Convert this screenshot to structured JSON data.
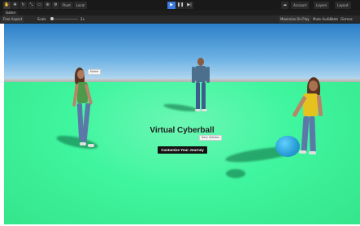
{
  "toolbar": {
    "tool_icons": [
      "hand-icon",
      "move-icon",
      "rotate-icon",
      "scale-icon",
      "rect-icon",
      "transform-icon",
      "custom-icon"
    ],
    "pivot_label": "Pivot",
    "local_label": "Local",
    "play_icons": [
      "play-icon",
      "pause-icon",
      "step-icon"
    ],
    "account_label": "Account",
    "layers_label": "Layers",
    "layout_label": "Layout"
  },
  "tab": {
    "label": "Game"
  },
  "gamebar": {
    "aspect": "Free Aspect",
    "scale_label": "Scale",
    "scale_value": "2x",
    "maximize": "Maximize On Play",
    "mute": "Mute Audio",
    "stats": "Stats",
    "gizmos": "Gizmos"
  },
  "scene": {
    "nametag_left": "Name",
    "nametag_center": "Kary Advisor",
    "title": "Virtual Cyberball",
    "cta_label": "Customize Your Journey"
  },
  "colors": {
    "ground": "#3ff59e",
    "ball": "#2b9fd8",
    "cta_bg": "#121212",
    "play_active": "#3d7be0"
  }
}
